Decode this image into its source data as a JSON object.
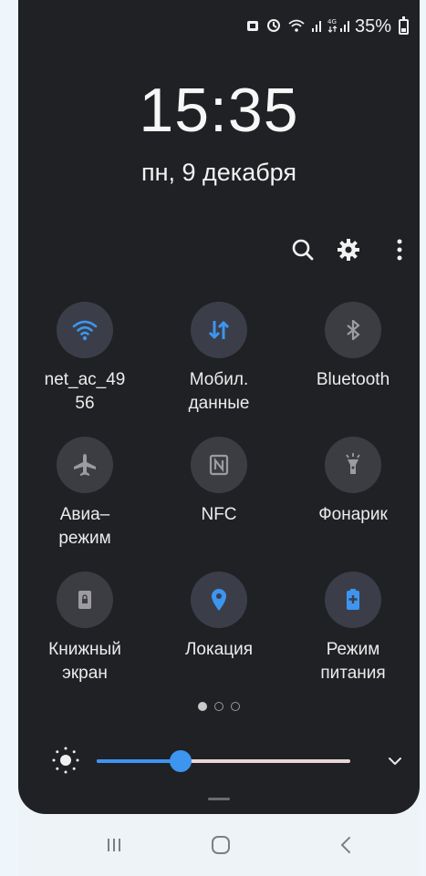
{
  "status_bar": {
    "network_type": "4G",
    "battery_percent": "35%",
    "battery_level": 0.35
  },
  "lock": {
    "time": "15:35",
    "date": "пн, 9 декабря"
  },
  "toolbar": {
    "search_icon": "search-icon",
    "settings_icon": "gear-icon",
    "more_icon": "more-vert-icon"
  },
  "tiles": [
    {
      "id": "wifi",
      "label": "net_ac_49\n56",
      "active": true,
      "icon": "wifi-icon",
      "color": "#3d95f0"
    },
    {
      "id": "mobile-data",
      "label": "Мобил.\nданные",
      "active": true,
      "icon": "mobile-data-icon",
      "color": "#3d95f0"
    },
    {
      "id": "bluetooth",
      "label": "Bluetooth",
      "active": false,
      "icon": "bluetooth-icon",
      "color": "#9b9ba0"
    },
    {
      "id": "airplane",
      "label": "Авиа–\nрежим",
      "active": false,
      "icon": "airplane-icon",
      "color": "#9b9ba0"
    },
    {
      "id": "nfc",
      "label": "NFC",
      "active": false,
      "icon": "nfc-icon",
      "color": "#9b9ba0"
    },
    {
      "id": "flashlight",
      "label": "Фонарик",
      "active": false,
      "icon": "flashlight-icon",
      "color": "#9b9ba0"
    },
    {
      "id": "book-screen",
      "label": "Книжный\nэкран",
      "active": false,
      "icon": "screen-lock-icon",
      "color": "#9b9ba0"
    },
    {
      "id": "location",
      "label": "Локация",
      "active": true,
      "icon": "location-icon",
      "color": "#3d95f0"
    },
    {
      "id": "power-mode",
      "label": "Режим\nпитания",
      "active": true,
      "icon": "battery-saver-icon",
      "color": "#3d95f0"
    }
  ],
  "pager": {
    "pages": 3,
    "current": 1
  },
  "brightness": {
    "level": 0.33
  },
  "navbar": {
    "recents_icon": "recents-icon",
    "home_icon": "home-icon",
    "back_icon": "back-icon"
  },
  "colors": {
    "panel_bg": "#202124",
    "accent": "#3d95f0",
    "tile_bg": "#3c3d42"
  }
}
